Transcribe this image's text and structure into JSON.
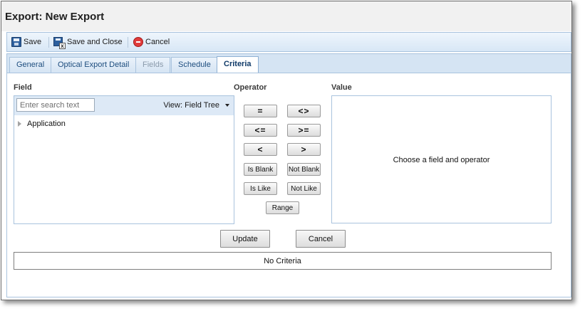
{
  "window": {
    "title": "Export: New Export"
  },
  "toolbar": {
    "save_label": "Save",
    "save_close_label": "Save and Close",
    "cancel_label": "Cancel"
  },
  "tabs": [
    {
      "label": "General",
      "state": "normal"
    },
    {
      "label": "Optical Export Detail",
      "state": "normal"
    },
    {
      "label": "Fields",
      "state": "disabled"
    },
    {
      "label": "Schedule",
      "state": "normal"
    },
    {
      "label": "Criteria",
      "state": "active"
    }
  ],
  "criteria": {
    "field_label": "Field",
    "operator_label": "Operator",
    "value_label": "Value",
    "search": {
      "placeholder": "Enter search text",
      "value": ""
    },
    "view_select": {
      "label": "View: Field Tree"
    },
    "tree": [
      {
        "label": "Application",
        "icon": "collapsed-arrow-icon"
      }
    ],
    "operators": {
      "eq": "=",
      "ne": "<>",
      "le": "<=",
      "ge": ">=",
      "lt": "<",
      "gt": ">",
      "is_blank": "Is Blank",
      "not_blank": "Not Blank",
      "is_like": "Is Like",
      "not_like": "Not Like",
      "range": "Range"
    },
    "value_placeholder": "Choose a field and operator",
    "update_label": "Update",
    "cancel_label": "Cancel",
    "criteria_list_text": "No Criteria"
  },
  "colors": {
    "toolbar_bg": "#d8e7f6",
    "tab_active_text": "#0f3a68",
    "border": "#a9c3de"
  }
}
